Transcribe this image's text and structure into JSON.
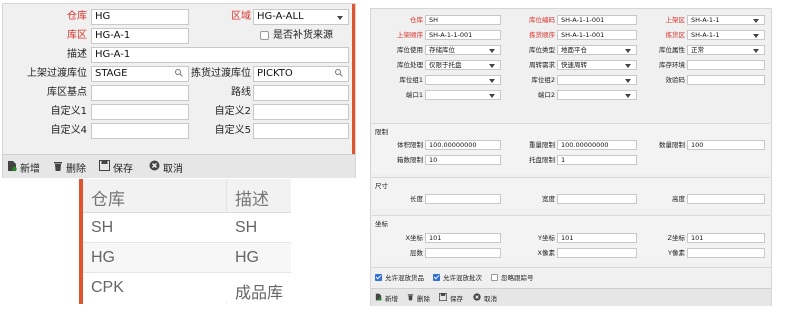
{
  "left_form": {
    "warehouse_label": "仓库",
    "warehouse_value": "HG",
    "region_label": "区域",
    "region_value": "HG-A-ALL",
    "zone_label": "库区",
    "zone_value": "HG-A-1",
    "replenish_label": "是否补货来源",
    "desc_label": "描述",
    "desc_value": "HG-A-1",
    "putaway_transit_label": "上架过渡库位",
    "putaway_transit_value": "STAGE",
    "pick_transit_label": "拣货过渡库位",
    "pick_transit_value": "PICKTO",
    "base_point_label": "库区基点",
    "base_point_value": "",
    "path_label": "路线",
    "path_value": "",
    "custom1_label": "自定义1",
    "custom1_value": "",
    "custom2_label": "自定义2",
    "custom2_value": "",
    "custom4_label": "自定义4",
    "custom4_value": "",
    "custom5_label": "自定义5",
    "custom5_value": ""
  },
  "left_toolbar": {
    "new": "新增",
    "delete": "删除",
    "save": "保存",
    "cancel": "取消"
  },
  "warehouse_table": {
    "headers": [
      "仓库",
      "描述"
    ],
    "rows": [
      [
        "SH",
        "SH"
      ],
      [
        "HG",
        "HG"
      ],
      [
        "CPK",
        "成品库"
      ]
    ]
  },
  "right_form": {
    "warehouse_label": "仓库",
    "warehouse_value": "SH",
    "location_code_label": "库位编码",
    "location_code_value": "SH-A-1-1-001",
    "putaway_zone_label": "上架区",
    "putaway_zone_value": "SH-A-1-1",
    "putaway_seq_label": "上架顺序",
    "putaway_seq_value": "SH-A-1-1-001",
    "pick_seq_label": "拣货顺序",
    "pick_seq_value": "SH-A-1-1-001",
    "pick_zone_label": "拣货区",
    "pick_zone_value": "SH-A-1-1",
    "usage_label": "库位使用",
    "usage_value": "存储库位",
    "type_label": "库位类型",
    "type_value": "地面平仓",
    "attr_label": "库位属性",
    "attr_value": "正常",
    "handling_label": "库位处理",
    "handling_value": "仅限于托盘",
    "turnover_label": "周转需求",
    "turnover_value": "快速周转",
    "env_label": "库存环境",
    "env_value": "",
    "group1_label": "库位组1",
    "group1_value": "",
    "group2_label": "库位组2",
    "group2_value": "",
    "check_code_label": "效验码",
    "check_code_value": "",
    "port1_label": "端口1",
    "port1_value": "",
    "port2_label": "端口2",
    "port2_value": "",
    "limits_title": "限制",
    "volume_label": "体积限制",
    "volume_value": "100.00000000",
    "weight_label": "重量限制",
    "weight_value": "100.00000000",
    "qty_label": "数量限制",
    "qty_value": "100",
    "box_label": "箱数限制",
    "box_value": "10",
    "pallet_label": "托盘限制",
    "pallet_value": "1",
    "size_title": "尺寸",
    "length_label": "长度",
    "length_value": "",
    "width_label": "宽度",
    "width_value": "",
    "height_label": "高度",
    "height_value": "",
    "coord_title": "坐标",
    "x_label": "X坐标",
    "x_value": "101",
    "y_label": "Y坐标",
    "y_value": "101",
    "z_label": "Z坐标",
    "z_value": "101",
    "layer_label": "层数",
    "layer_value": "",
    "xpix_label": "X像素",
    "xpix_value": "",
    "ypix_label": "Y像素",
    "ypix_value": "",
    "mix_goods_label": "允许混放货品",
    "mix_batch_label": "允许混放批次",
    "ignore_trace_label": "忽略跟踪号"
  },
  "right_toolbar": {
    "new": "新增",
    "delete": "删除",
    "save": "保存",
    "cancel": "取消"
  },
  "colors": {
    "required": "#d9342b",
    "accent_bar": "#e0542f",
    "checkbox": "#2f6fd6"
  }
}
